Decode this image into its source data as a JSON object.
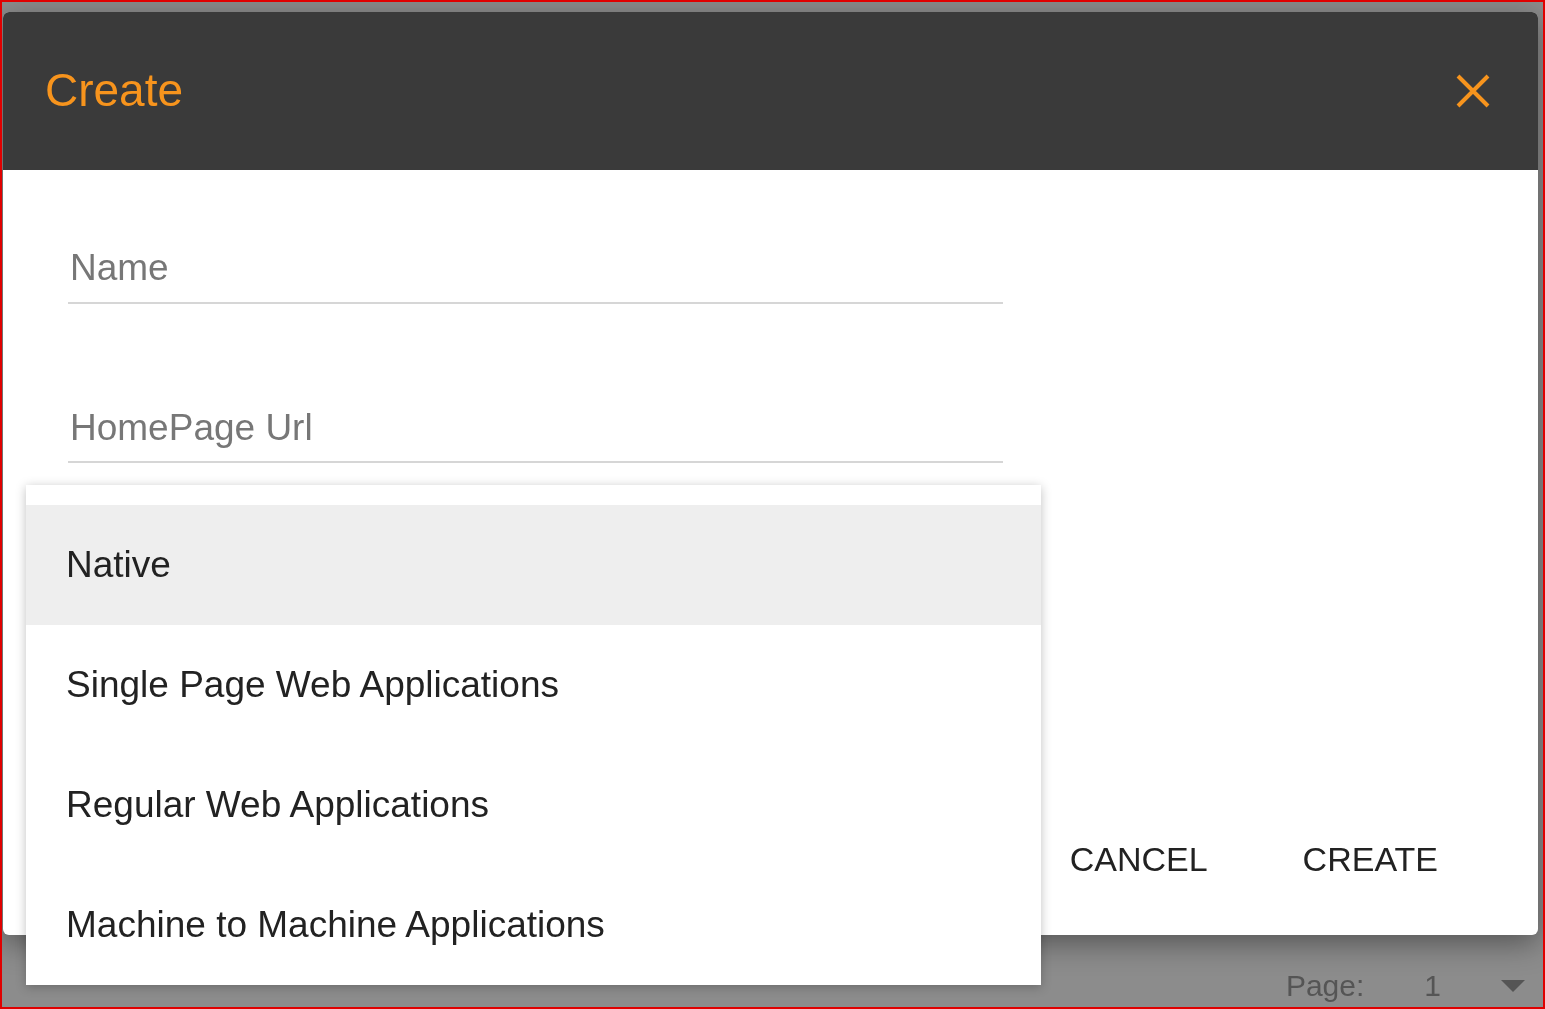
{
  "dialog": {
    "title": "Create",
    "fields": [
      {
        "placeholder": "Name"
      },
      {
        "placeholder": "HomePage Url"
      }
    ],
    "buttons": [
      "CANCEL",
      "CREATE"
    ]
  },
  "dropdown": {
    "options": [
      {
        "label": "Native",
        "selected": true
      },
      {
        "label": "Single Page Web Applications",
        "selected": false
      },
      {
        "label": "Regular Web Applications",
        "selected": false
      },
      {
        "label": "Machine to Machine Applications",
        "selected": false
      }
    ]
  },
  "pager": {
    "label": "Page:",
    "value": "1"
  }
}
